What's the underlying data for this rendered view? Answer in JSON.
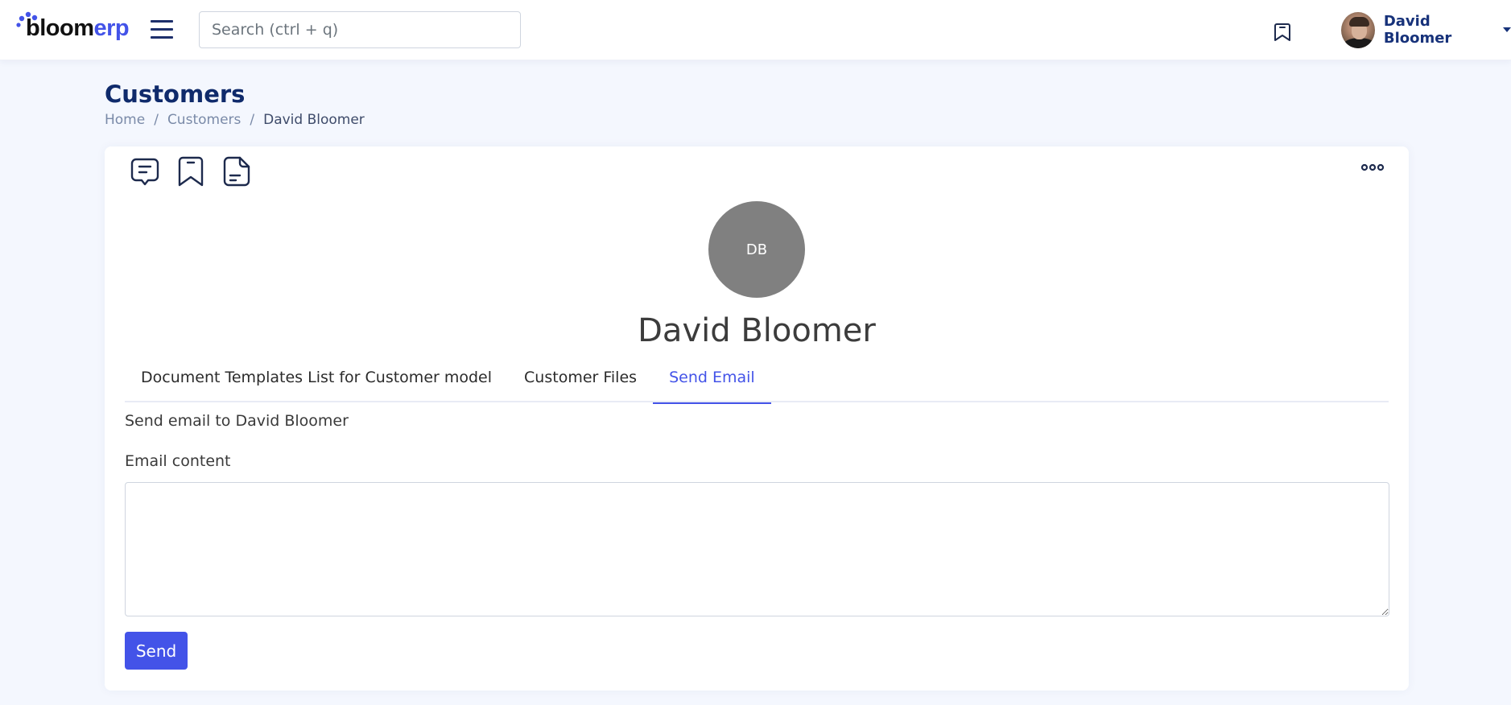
{
  "brand": {
    "name_part1": "bloom",
    "name_part2": "erp",
    "accent_color": "#4353e8"
  },
  "navbar": {
    "menu_icon": "hamburger-icon",
    "search": {
      "placeholder": "Search (ctrl + q)",
      "value": ""
    },
    "bookmark_icon": "bookmark-icon",
    "user": {
      "name": "David Bloomer",
      "avatar": "user-photo",
      "dropdown_icon": "caret-down-icon"
    }
  },
  "page": {
    "title": "Customers",
    "breadcrumb": [
      {
        "label": "Home"
      },
      {
        "label": "Customers"
      },
      {
        "label": "David Bloomer"
      }
    ],
    "breadcrumb_separator": "/"
  },
  "record": {
    "actions": [
      {
        "icon": "comment-icon",
        "label": "Comments"
      },
      {
        "icon": "bookmark-icon",
        "label": "Bookmark"
      },
      {
        "icon": "document-icon",
        "label": "Documents"
      }
    ],
    "more_icon": "more-options-icon",
    "initials": "DB",
    "name": "David Bloomer",
    "tabs": [
      {
        "label": "Document Templates List for Customer model",
        "active": false
      },
      {
        "label": "Customer Files",
        "active": false
      },
      {
        "label": "Send Email",
        "active": true
      }
    ]
  },
  "send_email": {
    "heading": "Send email to David Bloomer",
    "content_label": "Email content",
    "content_value": "",
    "send_label": "Send"
  }
}
